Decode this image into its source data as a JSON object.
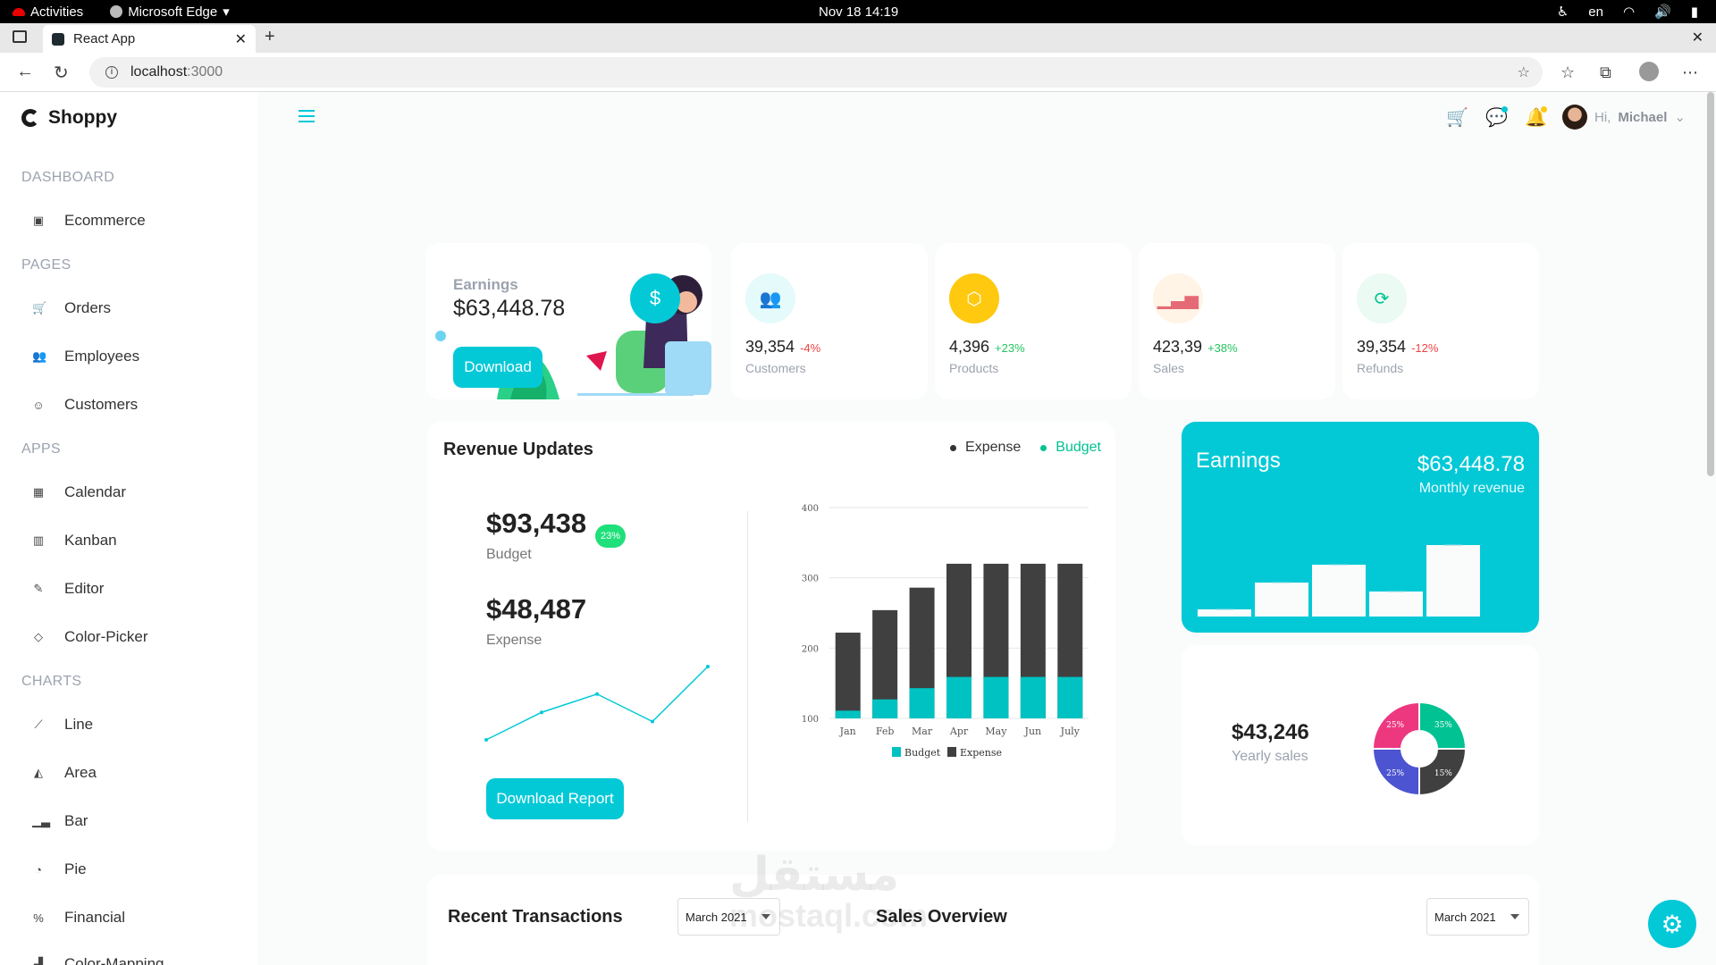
{
  "system": {
    "activities": "Activities",
    "app_name": "Microsoft Edge",
    "clock": "Nov 18  14:19",
    "lang": "en"
  },
  "browser": {
    "tab_title": "React App",
    "url_host": "localhost",
    "url_port": ":3000"
  },
  "sidebar": {
    "brand": "Shoppy",
    "sections": [
      {
        "title": "DASHBOARD",
        "items": [
          {
            "label": "Ecommerce",
            "icon": "bag-icon"
          }
        ]
      },
      {
        "title": "PAGES",
        "items": [
          {
            "label": "Orders",
            "icon": "cart-icon"
          },
          {
            "label": "Employees",
            "icon": "employees-icon"
          },
          {
            "label": "Customers",
            "icon": "customers-icon"
          }
        ]
      },
      {
        "title": "APPS",
        "items": [
          {
            "label": "Calendar",
            "icon": "calendar-icon"
          },
          {
            "label": "Kanban",
            "icon": "kanban-icon"
          },
          {
            "label": "Editor",
            "icon": "editor-icon"
          },
          {
            "label": "Color-Picker",
            "icon": "color-picker-icon"
          }
        ]
      },
      {
        "title": "CHARTS",
        "items": [
          {
            "label": "Line",
            "icon": "line-chart-icon"
          },
          {
            "label": "Area",
            "icon": "area-chart-icon"
          },
          {
            "label": "Bar",
            "icon": "bar-chart-icon"
          },
          {
            "label": "Pie",
            "icon": "pie-chart-icon"
          },
          {
            "label": "Financial",
            "icon": "financial-icon"
          },
          {
            "label": "Color-Mapping",
            "icon": "color-mapping-icon"
          }
        ]
      }
    ]
  },
  "header": {
    "greeting": "Hi,",
    "user_name": "Michael"
  },
  "earnings_card": {
    "label": "Earnings",
    "amount": "$63,448.78",
    "button": "Download"
  },
  "stats": [
    {
      "value": "39,354",
      "change": "-4%",
      "name": "Customers",
      "icon": "customers-icon",
      "color": "#03c9d7",
      "bg": "#e5fafb",
      "change_color": "#ef4444"
    },
    {
      "value": "4,396",
      "change": "+23%",
      "name": "Products",
      "icon": "box-icon",
      "color": "#ffffff",
      "bg": "#fec90f",
      "change_color": "#22c55e"
    },
    {
      "value": "423,39",
      "change": "+38%",
      "name": "Sales",
      "icon": "bar-chart-icon",
      "color": "#e46a76",
      "bg": "#fff4e5",
      "change_color": "#22c55e"
    },
    {
      "value": "39,354",
      "change": "-12%",
      "name": "Refunds",
      "icon": "refresh-icon",
      "color": "#00c292",
      "bg": "#ebfaf2",
      "change_color": "#ef4444"
    }
  ],
  "revenue": {
    "title": "Revenue Updates",
    "legend": [
      {
        "label": "Expense",
        "color": "#333333"
      },
      {
        "label": "Budget",
        "color": "#00c292"
      }
    ],
    "budget_amount": "$93,438",
    "budget_badge": "23%",
    "budget_label": "Budget",
    "expense_amount": "$48,487",
    "expense_label": "Expense",
    "button": "Download Report",
    "sparkline": [
      2,
      5,
      7,
      4,
      10
    ]
  },
  "monthly": {
    "title": "Earnings",
    "amount": "$63,448.78",
    "subtitle": "Monthly revenue",
    "bars": [
      8,
      38,
      58,
      28,
      80
    ]
  },
  "yearly": {
    "amount": "$43,246",
    "subtitle": "Yearly sales"
  },
  "bottom": {
    "transactions_title": "Recent Transactions",
    "sales_title": "Sales Overview",
    "month_select": "March 2021"
  },
  "watermark": {
    "arabic": "مستقل",
    "latin": "mostaql.com"
  },
  "chart_data": [
    {
      "type": "bar",
      "categories": [
        "Jan",
        "Feb",
        "Mar",
        "Apr",
        "May",
        "Jun",
        "July"
      ],
      "series": [
        {
          "name": "Budget",
          "values": [
            111,
            127,
            143,
            159,
            159,
            159,
            159
          ],
          "color": "#00c2c2"
        },
        {
          "name": "Expense",
          "values": [
            222,
            254,
            286,
            320,
            320,
            320,
            320
          ],
          "color": "#404041"
        }
      ],
      "ylim": [
        100,
        400
      ],
      "yticks": [
        100,
        200,
        300,
        400
      ],
      "legend": "bottom",
      "stacked": "overlay"
    },
    {
      "type": "pie",
      "donut": true,
      "slices": [
        {
          "label": "35%",
          "value": 25,
          "color": "#00c292"
        },
        {
          "label": "15%",
          "value": 25,
          "color": "#404041"
        },
        {
          "label": "25%",
          "value": 25,
          "color": "#4c54d1"
        },
        {
          "label": "25%",
          "value": 25,
          "color": "#ed3880"
        }
      ]
    }
  ]
}
